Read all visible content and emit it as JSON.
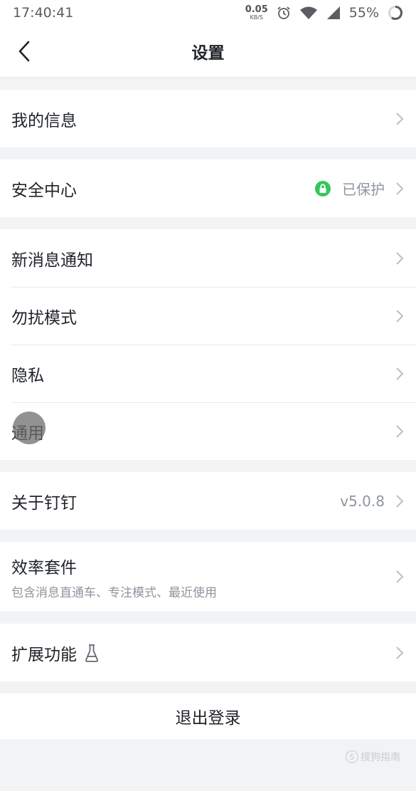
{
  "status_bar": {
    "time": "17:40:41",
    "net_speed_value": "0.05",
    "net_speed_unit": "KB/S",
    "battery": "55%"
  },
  "nav": {
    "title": "设置"
  },
  "groups": {
    "my_info": {
      "label": "我的信息"
    },
    "security": {
      "label": "安全中心",
      "value": "已保护"
    },
    "notify": {
      "label": "新消息通知"
    },
    "dnd": {
      "label": "勿扰模式"
    },
    "privacy": {
      "label": "隐私"
    },
    "general": {
      "label": "通用"
    },
    "about": {
      "label": "关于钉钉",
      "value": "v5.0.8"
    },
    "efficiency": {
      "label": "效率套件",
      "sub": "包含消息直通车、专注模式、最近使用"
    },
    "extensions": {
      "label": "扩展功能"
    }
  },
  "logout": {
    "label": "退出登录"
  },
  "watermark": {
    "letter": "S",
    "text": "搜狗指南"
  },
  "colors": {
    "accent_green": "#34c759",
    "background": "#f2f3f5"
  }
}
